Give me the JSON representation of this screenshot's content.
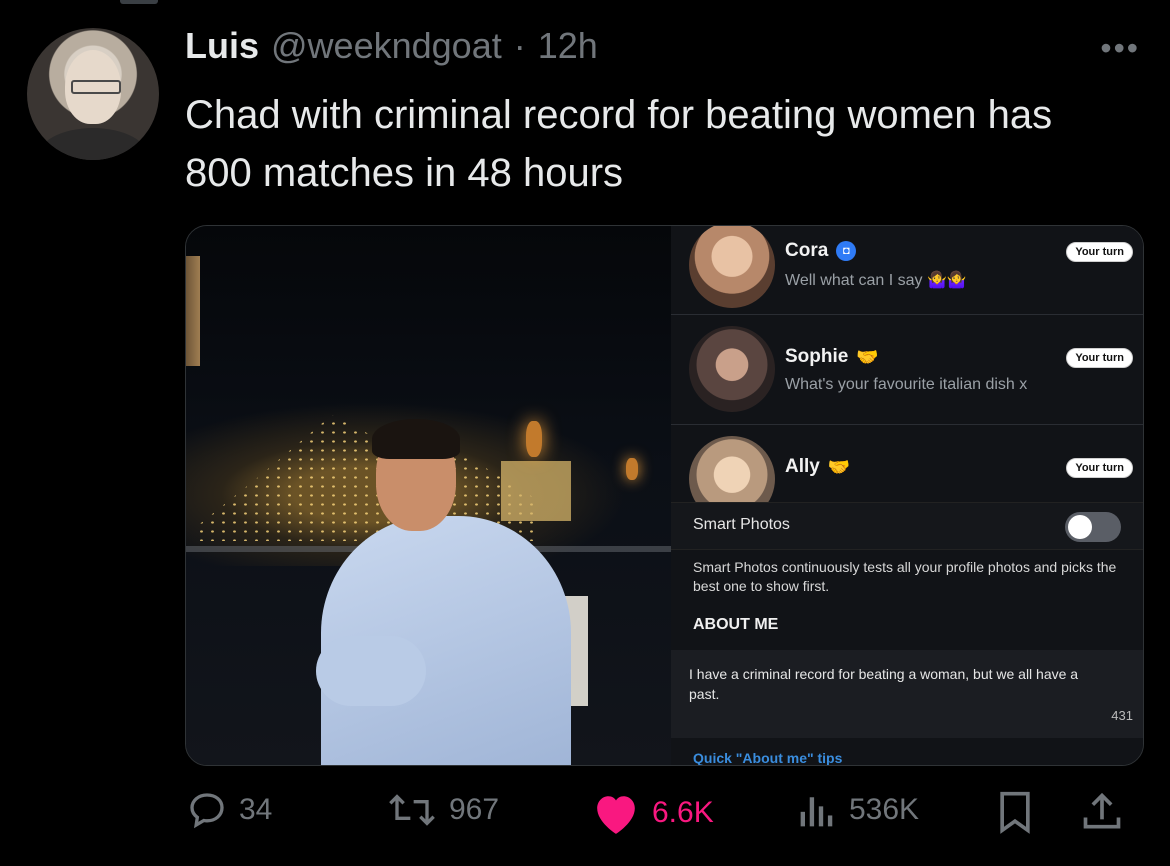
{
  "tweet": {
    "author_name": "Luis",
    "handle": "@weekndgoat",
    "separator": "·",
    "time": "12h",
    "more": "•••",
    "text": "Chad with criminal record for beating women has 800 matches in 48 hours"
  },
  "screenshot": {
    "matches": [
      {
        "name": "Cora",
        "badge": "camera-verified-icon",
        "preview": "Well what can I say 🤷‍♀️🤷‍♀️",
        "action": "Your turn"
      },
      {
        "name": "Sophie",
        "badge": "hand-icon",
        "preview": "What's your favourite italian dish x",
        "action": "Your turn"
      },
      {
        "name": "Ally",
        "badge": "hand-icon",
        "preview": "",
        "action": "Your turn"
      }
    ],
    "smart_photos_label": "Smart Photos",
    "smart_photos_description": "Smart Photos continuously tests all your profile photos and picks the best one to show first.",
    "about_me_heading": "ABOUT ME",
    "about_me_text": "I have a criminal record for beating a woman, but we all have a past.",
    "about_me_count": "431",
    "tips_link": "Quick \"About me\" tips"
  },
  "actions": {
    "replies": "34",
    "reposts": "967",
    "likes": "6.6K",
    "views": "536K"
  },
  "colors": {
    "background": "#000000",
    "secondary_text": "#71767b",
    "like_pink": "#f91880",
    "link_blue": "#3a8dde"
  }
}
